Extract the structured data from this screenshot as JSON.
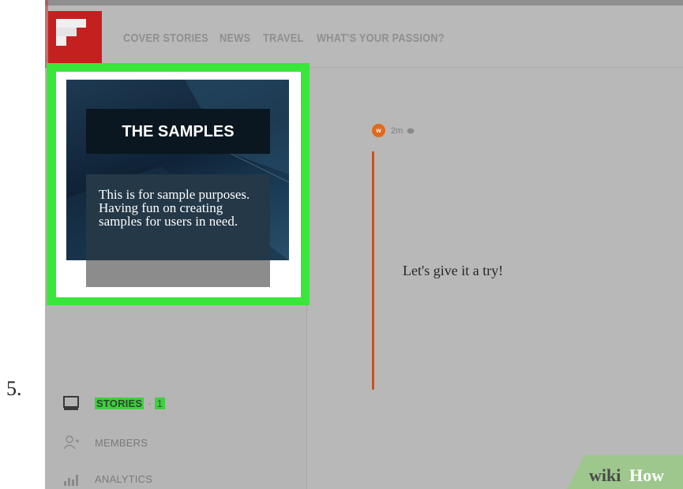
{
  "step": {
    "number": "5."
  },
  "header": {
    "nav": [
      "COVER STORIES",
      "NEWS",
      "TRAVEL",
      "WHAT'S YOUR PASSION?"
    ]
  },
  "card": {
    "title": "THE SAMPLES",
    "description": "This is for sample purposes. Having fun on creating samples for users in need."
  },
  "sidebar": {
    "stories_label": "STORIES",
    "stories_separator": "·",
    "stories_count": "1",
    "members_label": "MEMBERS",
    "analytics_label": "ANALYTICS"
  },
  "post": {
    "avatar_letter": "w",
    "time": "2m",
    "text": "Let's give it a try!"
  },
  "watermark": {
    "wiki": "wiki",
    "how": "How"
  },
  "colors": {
    "highlight": "#39e63a",
    "logo": "#c42020",
    "accent_line": "#c8541c",
    "avatar": "#e06a1e"
  },
  "icons": [
    "flipboard-logo-icon",
    "stories-icon",
    "add-member-icon",
    "analytics-icon",
    "comment-icon"
  ]
}
